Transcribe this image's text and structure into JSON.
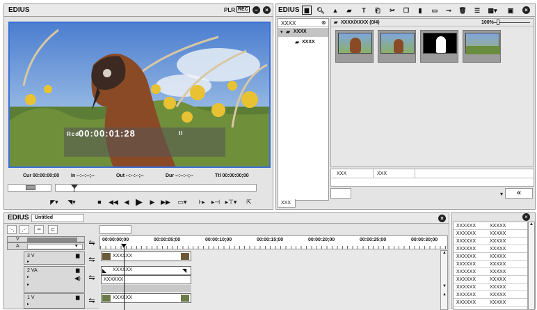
{
  "player": {
    "title": "EDIUS",
    "plr_label": "PLR",
    "rec_label": "REC",
    "timecode_prefix": "Rcd",
    "timecode": "00:00:01:28",
    "pause_glyph": "II",
    "info": {
      "cur": "Cur 00:00:00;00",
      "in": "In --:--:--;--",
      "out": "Out --:--:--;--",
      "dur": "Dur --:--:--;--",
      "ttl": "Ttl 00:00:00;00"
    }
  },
  "bin": {
    "title": "EDIUS",
    "tree_header": "XXXX",
    "tree_root": "XXXX",
    "tree_child": "XXXX",
    "path": "XXXX/XXXX (0/4)",
    "zoom": "100%",
    "props": [
      "XXX",
      "XXX"
    ],
    "tab": "XXX",
    "collapse": "«"
  },
  "timeline": {
    "title": "EDIUS",
    "project": "Untitled",
    "track_v": "V",
    "track_a": "A",
    "ruler": [
      "00:00:00;00",
      "00:00:05;00",
      "00:00:10;00",
      "00:00:15;00",
      "00:00:20;00",
      "00:00:25;00",
      "00:00:30;00"
    ],
    "tracks": [
      {
        "name": "3 V",
        "clip": "XXXXXX"
      },
      {
        "name": "2 VA",
        "clip": "XXXXXX",
        "clip_audio": "XXXXXX"
      },
      {
        "name": "1 V",
        "clip": "XXXXXX"
      }
    ]
  },
  "side": {
    "rows": [
      [
        "XXXXXX",
        "XXXXX"
      ],
      [
        "XXXXXX",
        "XXXXX"
      ],
      [
        "XXXXXX",
        "XXXXX"
      ],
      [
        "XXXXXX",
        "XXXXX"
      ],
      [
        "XXXXXX",
        "XXXXX"
      ],
      [
        "XXXXXX",
        "XXXXX"
      ],
      [
        "XXXXXX",
        "XXXXX"
      ],
      [
        "XXXXXX",
        "XXXXX"
      ],
      [
        "XXXXXX",
        "XXXXX"
      ],
      [
        "XXXXXX",
        "XXXXX"
      ],
      [
        "XXXXXX",
        "XXXXX"
      ]
    ]
  },
  "colors": {
    "preview_border": "#3b6fd8",
    "accent_blue": "#3b6fd8"
  }
}
